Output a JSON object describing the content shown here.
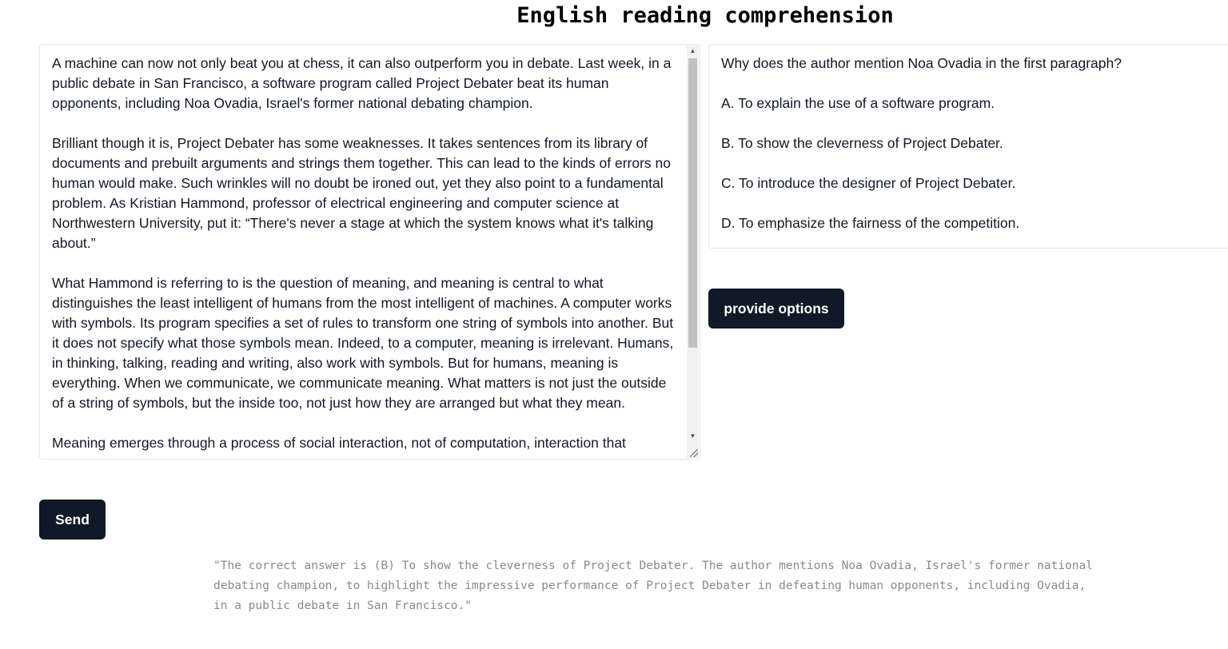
{
  "header": {
    "title": "English reading comprehension"
  },
  "passage": {
    "text": "A machine can now not only beat you at chess, it can also outperform you in debate. Last week, in a public debate in San Francisco, a software program called Project Debater beat its human opponents, including Noa Ovadia, Israel's former national debating champion.\n\nBrilliant though it is, Project Debater has some weaknesses. It takes sentences from its library of documents and prebuilt arguments and strings them together. This can lead to the kinds of errors no human would make. Such wrinkles will no doubt be ironed out, yet they also point to a fundamental problem. As Kristian Hammond, professor of electrical engineering and computer science at Northwestern University, put it: “There's never a stage at which the system knows what it's talking about.”\n\nWhat Hammond is referring to is the question of meaning, and meaning is central to what distinguishes the least intelligent of humans from the most intelligent of machines. A computer works with symbols. Its program specifies a set of rules to transform one string of symbols into another. But it does not specify what those symbols mean. Indeed, to a computer, meaning is irrelevant. Humans, in thinking, talking, reading and writing, also work with symbols. But for humans, meaning is everything. When we communicate, we communicate meaning. What matters is not just the outside of a string of symbols, but the inside too, not just how they are arranged but what they mean.\n\nMeaning emerges through a process of social interaction, not of computation, interaction that"
  },
  "question": {
    "text": "Why does the author mention Noa Ovadia in the first paragraph?\n\nA. To explain the use of a software program.\n\nB. To show the cleverness of Project Debater.\n\nC. To introduce the designer of Project Debater.\n\nD. To emphasize the fairness of the competition."
  },
  "buttons": {
    "provide_options": "provide options",
    "send": "Send"
  },
  "response": {
    "text": "\"The correct answer is (B) To show the cleverness of Project Debater. The author mentions Noa Ovadia, Israel's former national\ndebating champion, to highlight the impressive performance of Project Debater in defeating human opponents, including Ovadia,\nin a public debate in San Francisco.\""
  },
  "colors": {
    "button_bg": "#111827",
    "button_text": "#ffffff",
    "response_text": "#8a8a8a"
  }
}
